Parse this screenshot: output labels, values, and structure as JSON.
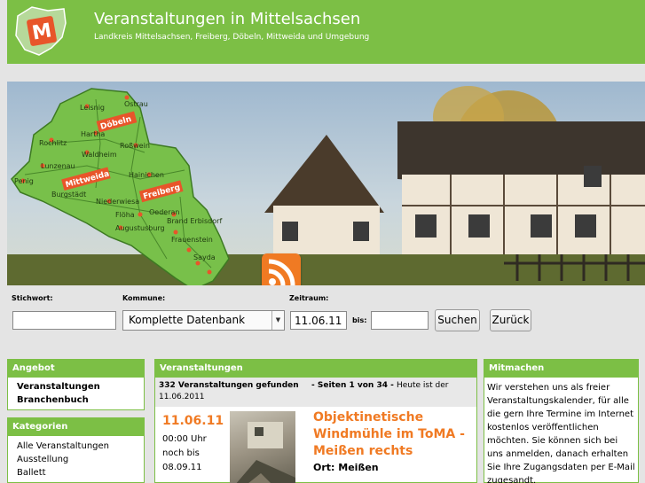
{
  "header": {
    "logo_letter": "M",
    "title": "Veranstaltungen in Mittelsachsen",
    "subtitle": "Landkreis Mittelsachsen, Freiberg, Döbeln, Mittweida und Umgebung"
  },
  "map": {
    "towns": [
      "Leisnig",
      "Ostrau",
      "Hartha",
      "Roßwein",
      "Rochlitz",
      "Waldheim",
      "Lunzenau",
      "Penig",
      "Burgstädt",
      "Hainichen",
      "Niederwiesa",
      "Flöha",
      "Oederan",
      "Augustusburg",
      "Brand Erbisdorf",
      "Frauenstein",
      "Sayda"
    ],
    "badges": [
      "Döbeln",
      "Mittweida",
      "Freiberg"
    ]
  },
  "search": {
    "keyword_label": "Stichwort:",
    "keyword_value": "",
    "kommune_label": "Kommune:",
    "kommune_selected": "Komplette Datenbank",
    "zeitraum_label": "Zeitraum:",
    "from_value": "11.06.11",
    "bis_label": "bis:",
    "to_value": "",
    "search_button": "Suchen",
    "back_button": "Zurück"
  },
  "angebot": {
    "heading": "Angebot",
    "items": [
      "Veranstaltungen",
      "Branchenbuch"
    ]
  },
  "kategorien": {
    "heading": "Kategorien",
    "items": [
      "Alle Veranstaltungen",
      "Ausstellung",
      "Ballett"
    ]
  },
  "veranstaltungen": {
    "heading": "Veranstaltungen",
    "found": "332 Veranstaltungen gefunden",
    "pages": "- Seiten 1 von 34 -",
    "today": "Heute ist der",
    "today_date": "11.06.2011",
    "event": {
      "date": "11.06.11",
      "time_line1": "00:00 Uhr",
      "time_line2": "noch bis",
      "time_line3": "08.09.11",
      "title": "Objektinetische Windmühle im ToMA - Meißen rechts",
      "ort": "Ort: Meißen"
    }
  },
  "mitmachen": {
    "heading": "Mitmachen",
    "text": "Wir verstehen uns als freier Veranstaltungskalender, für alle die gern Ihre Termine im Internet kostenlos veröffentlichen möchten. Sie können sich bei uns anmelden, danach erhalten Sie Ihre Zugangsdaten per E-Mail zugesandt."
  },
  "colors": {
    "brand_green": "#7cbf45",
    "accent_orange": "#f07a23",
    "badge_red": "#e8552a"
  }
}
